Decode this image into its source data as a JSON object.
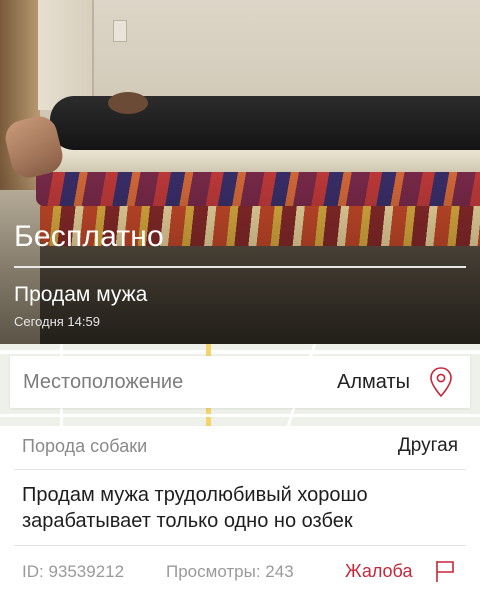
{
  "listing": {
    "price": "Бесплатно",
    "title": "Продам мужа",
    "date": "Сегодня 14:59"
  },
  "location": {
    "label": "Местоположение",
    "value": "Алматы",
    "icon": "location-pin-icon"
  },
  "breed": {
    "label": "Порода собаки",
    "value": "Другая"
  },
  "description": "Продам мужа трудолюбивый хорошо зарабатывает только одно но озбек",
  "footer": {
    "id_text": "ID: 93539212",
    "views_text": "Просмотры: 243",
    "complaint_label": "Жалоба",
    "complaint_icon": "flag-icon"
  },
  "colors": {
    "accent": "#c6273a",
    "muted_text": "#9a9a9a"
  }
}
